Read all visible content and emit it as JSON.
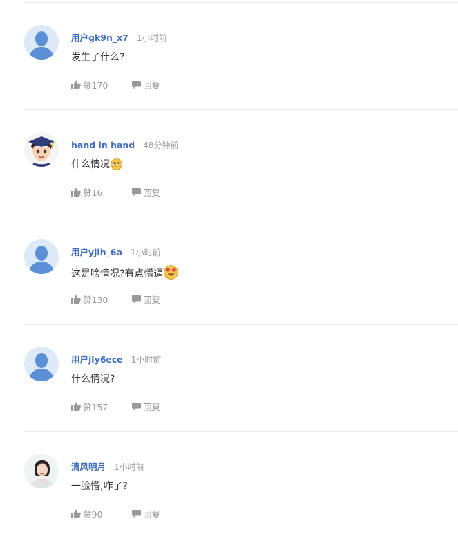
{
  "comments": [
    {
      "username": "用户gk9n_x7",
      "time": "1小时前",
      "text": "发生了什么?",
      "like_label": "赞170",
      "reply_label": "回复",
      "avatar": "default-avatar",
      "emoji": ""
    },
    {
      "username": "hand in hand",
      "time": "48分钟前",
      "text": "什么情况",
      "like_label": "赞16",
      "reply_label": "回复",
      "avatar": "graduate-cartoon-avatar",
      "emoji": "flushed-face"
    },
    {
      "username": "用户yjih_6a",
      "time": "1小时前",
      "text": "这是啥情况?有点懵逼",
      "like_label": "赞130",
      "reply_label": "回复",
      "avatar": "default-avatar",
      "emoji": "heart-eyes-face"
    },
    {
      "username": "用户jly6ece",
      "time": "1小时前",
      "text": "什么情况?",
      "like_label": "赞157",
      "reply_label": "回复",
      "avatar": "default-avatar",
      "emoji": ""
    },
    {
      "username": "清风明月",
      "time": "1小时前",
      "text": "一脸懵,咋了?",
      "like_label": "赞90",
      "reply_label": "回复",
      "avatar": "woman-photo-avatar",
      "emoji": ""
    }
  ],
  "colors": {
    "username": "#406fbf",
    "meta_text": "#999999",
    "content_text": "#333333",
    "divider": "#ececec",
    "default_avatar_bg": "#dceaf7",
    "default_avatar_fg": "#5b8fd6"
  }
}
